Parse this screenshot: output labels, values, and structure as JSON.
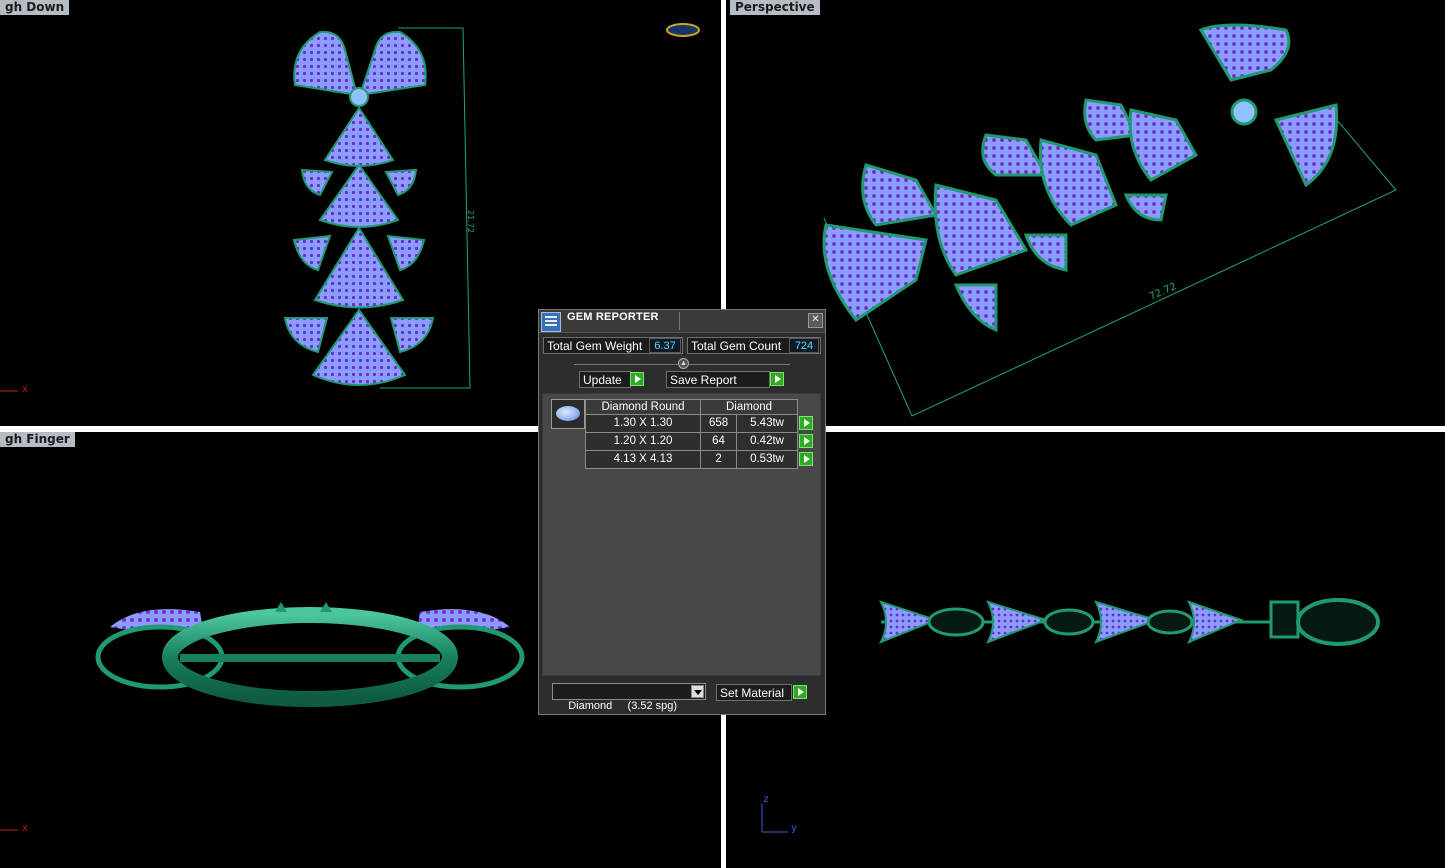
{
  "viewports": {
    "top": {
      "label": "gh Down",
      "axis_x": "x"
    },
    "perspective": {
      "label": "Perspective",
      "dimension": "72.72"
    },
    "front": {
      "label": "gh Finger",
      "axis_x": "x"
    },
    "side": {
      "axis_z": "z",
      "axis_y": "y"
    },
    "top_dimension": "21.72"
  },
  "gem_reporter": {
    "title": "GEM REPORTER",
    "close_glyph": "✕",
    "total_gem_weight_label": "Total Gem Weight",
    "total_gem_weight_value": "6.37",
    "total_gem_count_label": "Total Gem Count",
    "total_gem_count_value": "724",
    "update_label": "Update",
    "save_report_label": "Save Report",
    "table": {
      "headers": [
        "Diamond Round",
        "Diamond"
      ],
      "rows": [
        {
          "size": "1.30 X 1.30",
          "count": "658",
          "weight": "5.43tw"
        },
        {
          "size": "1.20 X 1.20",
          "count": "64",
          "weight": "0.42tw"
        },
        {
          "size": "4.13 X 4.13",
          "count": "2",
          "weight": "0.53tw"
        }
      ]
    },
    "material_select": "Diamond     (3.52 spg)",
    "set_material_label": "Set Material"
  },
  "colors": {
    "metal": "#1f9a72",
    "gem": "#8a9cff",
    "pave": "#6a2fc0",
    "dimension_line": "#1fa870"
  },
  "icons": {
    "gem_icon": "round-diamond-icon",
    "go": "green-arrow-icon",
    "ring_thumb": "ring-icon"
  }
}
